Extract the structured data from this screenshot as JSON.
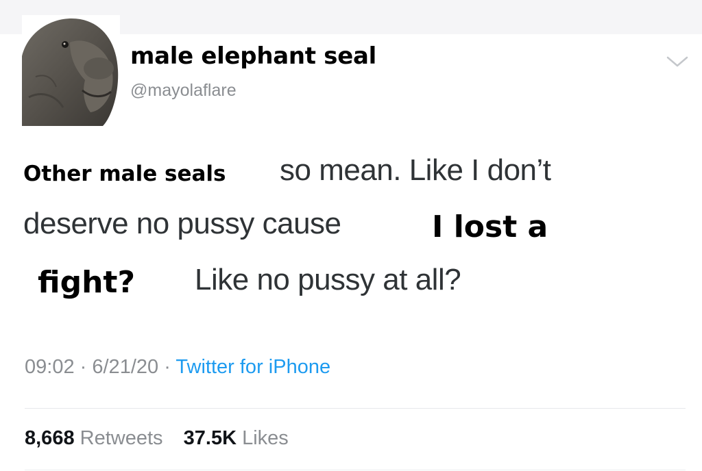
{
  "profile": {
    "display_name": "male elephant seal",
    "handle": "@mayolaflare"
  },
  "tweet": {
    "line1_overlay": "Other male seals",
    "line1_text": "so mean. Like I don’t",
    "line2_text": "deserve no pussy cause",
    "line2_overlay": "I lost a",
    "line3_overlay": "fight?",
    "line3_text": "Like no pussy at all?"
  },
  "meta": {
    "time": "09:02",
    "date": "6/21/20",
    "separator": "·",
    "source": "Twitter for iPhone"
  },
  "stats": {
    "retweets_count": "8,668",
    "retweets_label": "Retweets",
    "likes_count": "37.5K",
    "likes_label": "Likes"
  },
  "icons": {
    "avatar": "elephant-seal-avatar-icon",
    "more": "chevron-down-icon"
  },
  "colors": {
    "secondary_text": "#8a8d91",
    "link": "#1d9bf0",
    "primary_text": "#2f3336"
  }
}
